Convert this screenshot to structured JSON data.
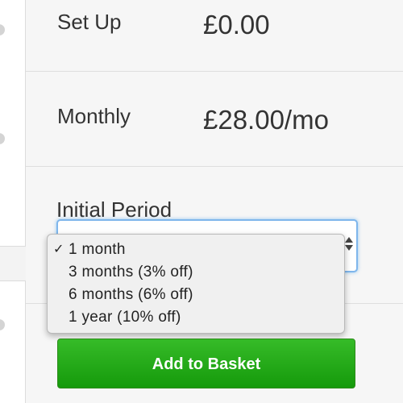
{
  "pricing": {
    "setup": {
      "label": "Set Up",
      "value": "£0.00"
    },
    "monthly": {
      "label": "Monthly",
      "value": "£28.00/mo"
    }
  },
  "period": {
    "label": "Initial Period",
    "options": [
      {
        "label": "1 month",
        "selected": true,
        "check": "✓"
      },
      {
        "label": "3 months (3% off)",
        "selected": false
      },
      {
        "label": "6 months (6% off)",
        "selected": false
      },
      {
        "label": "1 year (10% off)",
        "selected": false
      }
    ]
  },
  "actions": {
    "add_to_basket": "Add to Basket"
  },
  "colors": {
    "button_top": "#36bb28",
    "button_bottom": "#159a0b",
    "focus_border": "#7fb6ec"
  }
}
